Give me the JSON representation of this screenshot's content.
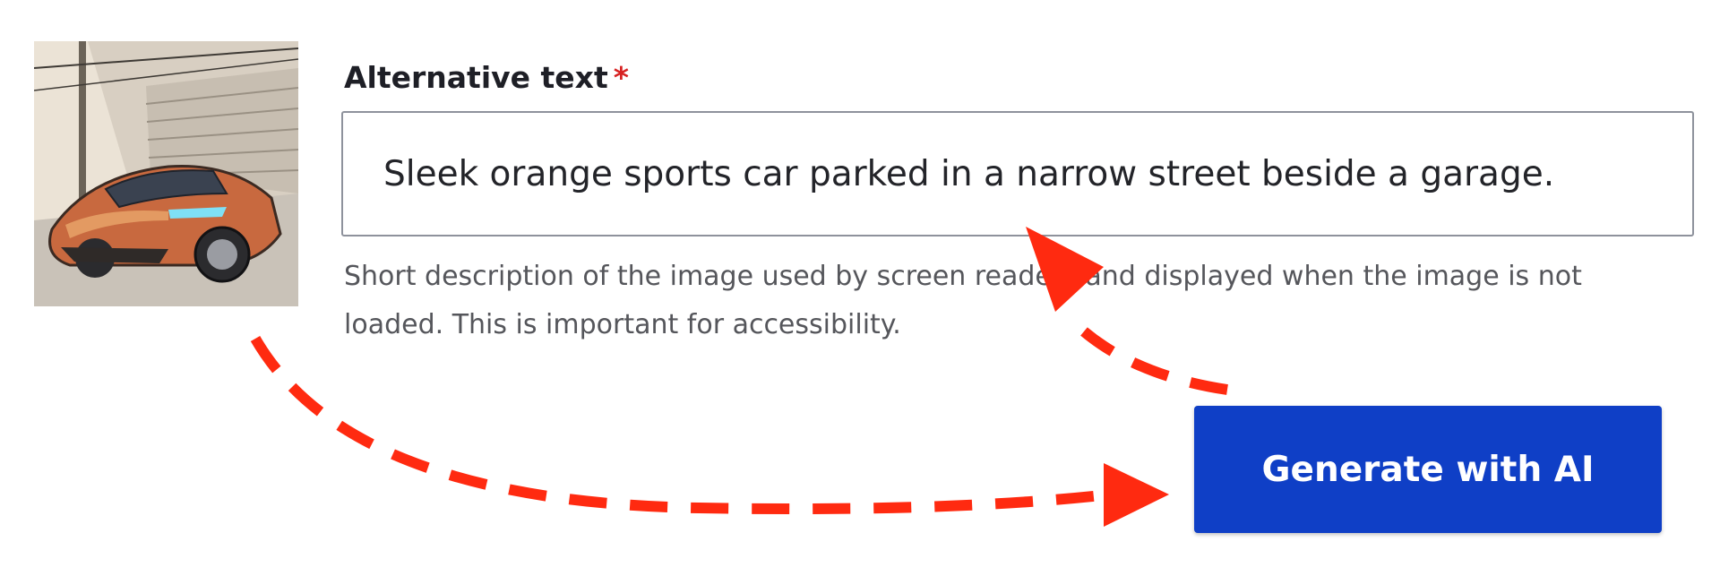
{
  "field": {
    "label": "Alternative text",
    "required_marker": "*",
    "value": "Sleek orange sports car parked in a narrow street beside a garage.",
    "help": "Short description of the image used by screen readers and displayed when the image is not loaded. This is important for accessibility."
  },
  "actions": {
    "generate_label": "Generate with AI"
  },
  "colors": {
    "accent": "#0f3fc6",
    "annotation_arrow": "#ff2a10",
    "required": "#d72222"
  }
}
